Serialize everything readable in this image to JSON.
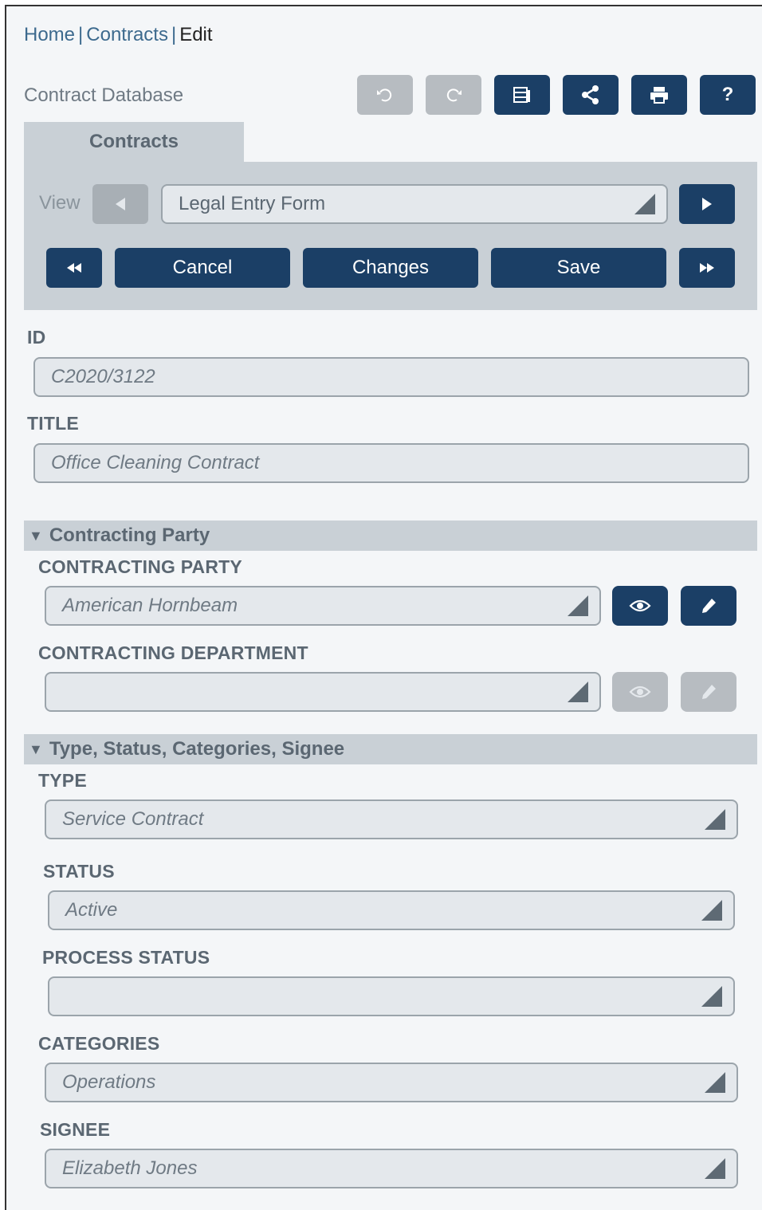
{
  "breadcrumb": {
    "home": "Home",
    "contracts": "Contracts",
    "current": "Edit",
    "separator": "|"
  },
  "app_title": "Contract Database",
  "toolbar": {
    "undo": "undo-icon",
    "redo": "redo-icon",
    "grid": "grid-icon",
    "share": "share-icon",
    "print": "print-icon",
    "help": "?"
  },
  "tabs": [
    {
      "label": "Contracts"
    }
  ],
  "view": {
    "label": "View",
    "selected": "Legal Entry Form"
  },
  "actions": {
    "cancel": "Cancel",
    "changes": "Changes",
    "save": "Save"
  },
  "fields": {
    "id": {
      "label": "ID",
      "value": "C2020/3122"
    },
    "title": {
      "label": "TITLE",
      "value": "Office Cleaning Contract"
    }
  },
  "sections": {
    "contracting_party": {
      "header": "Contracting Party",
      "party": {
        "label": "CONTRACTING PARTY",
        "value": "American Hornbeam"
      },
      "department": {
        "label": "CONTRACTING DEPARTMENT",
        "value": ""
      }
    },
    "type_status": {
      "header": "Type, Status, Categories, Signee",
      "type": {
        "label": "TYPE",
        "value": "Service Contract"
      },
      "status": {
        "label": "STATUS",
        "value": "Active"
      },
      "process_status": {
        "label": "PROCESS STATUS",
        "value": ""
      },
      "categories": {
        "label": "CATEGORIES",
        "value": "Operations"
      },
      "signee": {
        "label": "SIGNEE",
        "value": "Elizabeth Jones"
      }
    }
  },
  "colors": {
    "primary": "#1b3f66",
    "disabled": "#b7bcc1",
    "panel": "#c9d0d6",
    "field_bg": "#e4e8ec",
    "link": "#3d6a8e"
  }
}
